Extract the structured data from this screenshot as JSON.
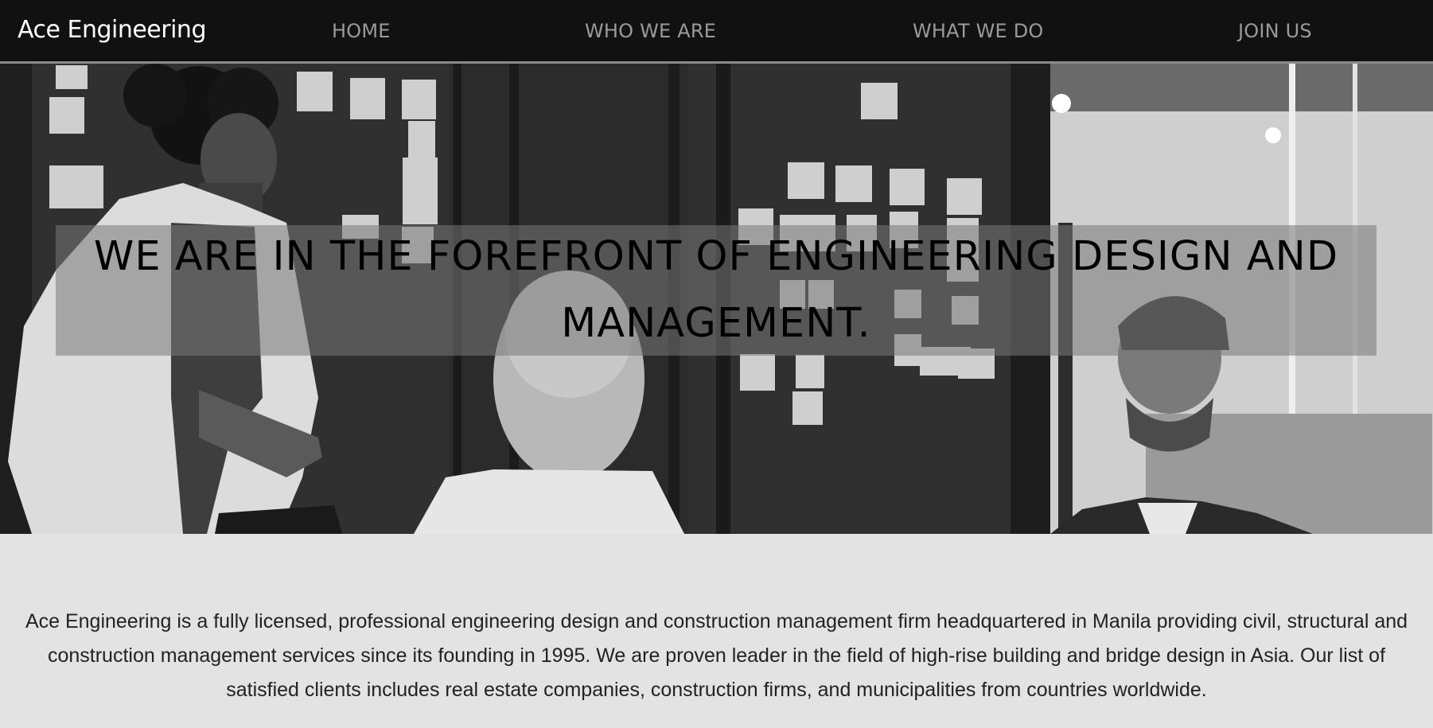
{
  "header": {
    "brand": "Ace Engineering",
    "nav": {
      "home": "HOME",
      "who": "WHO WE ARE",
      "what": "WHAT WE DO",
      "join": "JOIN US"
    }
  },
  "hero": {
    "heading": "WE ARE IN THE FOREFRONT OF ENGINEERING DESIGN AND MANAGEMENT."
  },
  "intro": {
    "text": "Ace Engineering is a fully licensed, professional engineering design and construction management firm headquartered in Manila providing civil, structural and construction management services since its founding in 1995. We are proven leader in the field of high-rise building and bridge design in Asia. Our list of satisfied clients includes real estate companies, construction firms, and municipalities from countries worldwide."
  },
  "colors": {
    "navbar_bg": "#111111",
    "nav_link": "#9a9a9a",
    "page_bg": "#e3e3e3",
    "text": "#222222"
  }
}
